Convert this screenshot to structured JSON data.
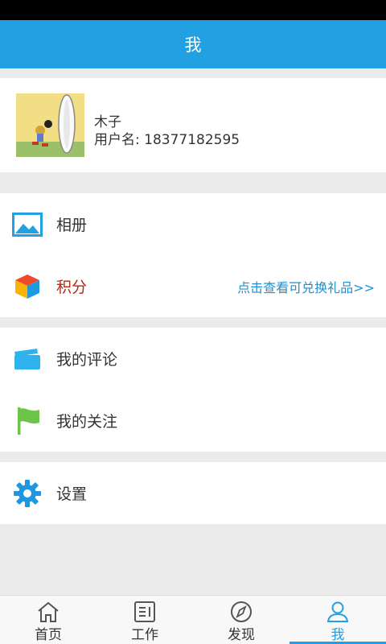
{
  "header": {
    "title": "我"
  },
  "profile": {
    "name": "木子",
    "username": "用户名: 18377182595"
  },
  "menu": {
    "album": {
      "label": "相册",
      "icon": "image-icon"
    },
    "points": {
      "label": "积分",
      "icon": "cube-icon",
      "link": "点击查看可兑换礼品>>"
    },
    "comments": {
      "label": "我的评论",
      "icon": "comment-card-icon"
    },
    "follows": {
      "label": "我的关注",
      "icon": "flag-icon"
    },
    "settings": {
      "label": "设置",
      "icon": "gear-icon"
    }
  },
  "nav": [
    {
      "label": "首页",
      "icon": "home-icon"
    },
    {
      "label": "工作",
      "icon": "work-list-icon"
    },
    {
      "label": "发现",
      "icon": "compass-icon"
    },
    {
      "label": "我",
      "icon": "user-icon",
      "active": true
    }
  ],
  "colors": {
    "accent": "#21a0e2",
    "points_label": "#b22a10",
    "link": "#1f8fcf"
  }
}
